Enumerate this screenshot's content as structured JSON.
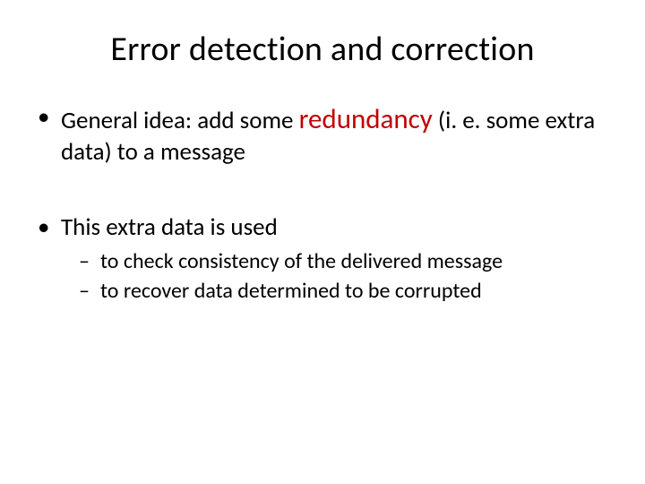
{
  "title": "Error detection and correction",
  "bullets": [
    {
      "prefix": "General idea: add some ",
      "keyword": "redundancy",
      "suffix": " (i. e. some extra data) to a message"
    },
    {
      "text": "This extra data is used",
      "sub": [
        "to check consistency of the delivered message",
        "to recover data determined to be corrupted"
      ]
    }
  ]
}
